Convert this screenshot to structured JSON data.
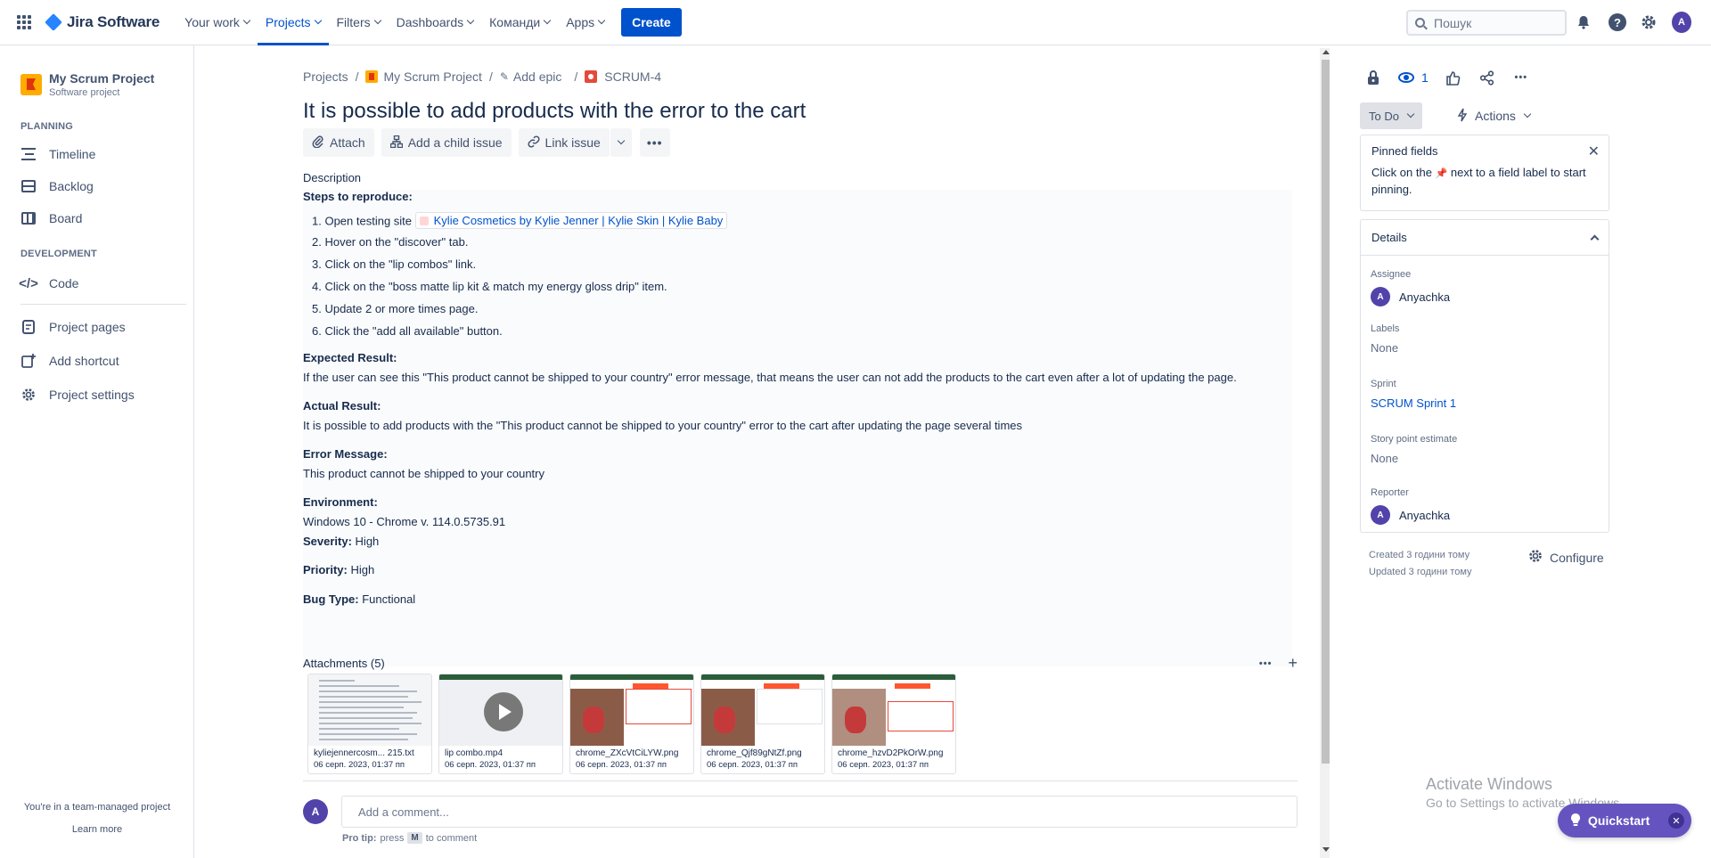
{
  "topbar": {
    "product_name": "Jira Software",
    "nav": [
      {
        "label": "Your work"
      },
      {
        "label": "Projects"
      },
      {
        "label": "Filters"
      },
      {
        "label": "Dashboards"
      },
      {
        "label": "Команди"
      },
      {
        "label": "Apps"
      }
    ],
    "create_label": "Create",
    "search_placeholder": "Пошук",
    "avatar_initial": "A",
    "accent_color": "#0052cc"
  },
  "sidebar": {
    "project_name": "My Scrum Project",
    "project_type": "Software project",
    "planning_heading": "PLANNING",
    "planning_items": [
      {
        "label": "Timeline"
      },
      {
        "label": "Backlog"
      },
      {
        "label": "Board"
      }
    ],
    "development_heading": "DEVELOPMENT",
    "code_label": "Code",
    "extra_items": [
      {
        "label": "Project pages"
      },
      {
        "label": "Add shortcut"
      },
      {
        "label": "Project settings"
      }
    ],
    "footer_text": "You're in a team-managed project",
    "learn_more": "Learn more"
  },
  "issue": {
    "breadcrumb": {
      "projects": "Projects",
      "project": "My Scrum Project",
      "epic": "Add epic",
      "key": "SCRUM-4"
    },
    "title": "It is possible to add products with the error to the cart",
    "toolbar": {
      "attach": "Attach",
      "child": "Add a child issue",
      "link": "Link issue"
    },
    "description_label": "Description",
    "description": {
      "steps_heading": "Steps to reproduce:",
      "step1_prefix": "1. Open testing site",
      "step1_link": "Kylie Cosmetics by Kylie Jenner | Kylie Skin | Kylie Baby",
      "step2": "2. Hover on the \"discover\" tab.",
      "step3": "3. Click on the \"lip combos\" link.",
      "step4": "4. Click on the \"boss matte lip kit & match my energy gloss drip\" item.",
      "step5": "5. Update 2 or more times page.",
      "step6": "6. Click the \"add all available\" button.",
      "expected_heading": "Expected Result:",
      "expected_text": "If the user can see this \"This product cannot be shipped to your country\" error message, that means the user can not add the products to the cart even after a lot of updating the page.",
      "actual_heading": "Actual Result:",
      "actual_text": "It is possible to add products with the \"This product cannot be shipped to your country\" error to the cart after updating the page several times",
      "error_heading": "Error Message:",
      "error_text": "This product cannot be shipped to your country",
      "env_heading": "Environment:",
      "env_text": "Windows 10 - Chrome v. 114.0.5735.91",
      "severity_label": "Severity:",
      "severity_value": "High",
      "priority_label": "Priority:",
      "priority_value": "High",
      "bugtype_label": "Bug Type:",
      "bugtype_value": "Functional"
    },
    "attachments_title": "Attachments (5)",
    "attachments": [
      {
        "name": "kyliejennercosm... 215.txt",
        "date": "06 серп. 2023, 01:37 пп"
      },
      {
        "name": "lip combo.mp4",
        "date": "06 серп. 2023, 01:37 пп"
      },
      {
        "name": "chrome_ZXcVtCiLYW.png",
        "date": "06 серп. 2023, 01:37 пп"
      },
      {
        "name": "chrome_Qjf89gNtZf.png",
        "date": "06 серп. 2023, 01:37 пп"
      },
      {
        "name": "chrome_hzvD2PkOrW.png",
        "date": "06 серп. 2023, 01:37 пп"
      }
    ],
    "comment_placeholder": "Add a comment...",
    "pro_tip": "Pro tip:",
    "pro_tip_press": "press",
    "pro_tip_key": "M",
    "pro_tip_rest": "to comment",
    "user_initial": "A"
  },
  "right_panel": {
    "watch_count": "1",
    "status": "To Do",
    "actions_label": "Actions",
    "pinned_title": "Pinned fields",
    "pinned_text_before": "Click on the",
    "pinned_text_after": "next to a field label to start pinning.",
    "details_title": "Details",
    "assignee_label": "Assignee",
    "assignee_value": "Anyachka",
    "labels_label": "Labels",
    "labels_value": "None",
    "sprint_label": "Sprint",
    "sprint_value": "SCRUM Sprint 1",
    "story_label": "Story point estimate",
    "story_value": "None",
    "reporter_label": "Reporter",
    "reporter_value": "Anyachka",
    "created": "Created 3 години тому",
    "updated": "Updated 3 години тому",
    "configure": "Configure"
  },
  "overlay": {
    "activate_title": "Activate Windows",
    "activate_sub": "Go to Settings to activate Windows.",
    "quickstart": "Quickstart",
    "quickstart_color": "#6554c0"
  }
}
